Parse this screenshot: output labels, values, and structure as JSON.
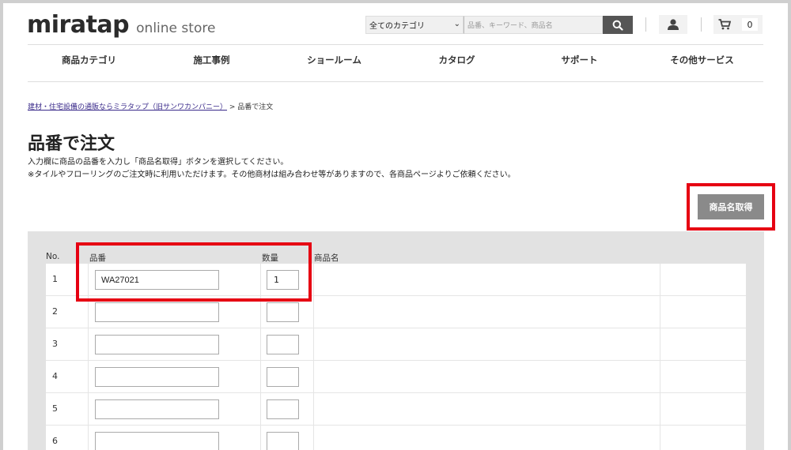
{
  "header": {
    "logo_main": "miratap",
    "logo_sub": "online store",
    "search": {
      "category_value": "全てのカテゴリ",
      "placeholder": "品番、キーワード、商品名"
    },
    "cart_count": "0"
  },
  "nav": {
    "items": [
      {
        "label": "商品カテゴリ"
      },
      {
        "label": "施工事例"
      },
      {
        "label": "ショールーム"
      },
      {
        "label": "カタログ"
      },
      {
        "label": "サポート"
      },
      {
        "label": "その他サービス"
      }
    ]
  },
  "breadcrumb": {
    "link": "建材・住宅設備の通販ならミラタップ（旧サンワカンパニー）",
    "separator": " > ",
    "current": "品番で注文"
  },
  "page": {
    "title": "品番で注文",
    "desc1": "入力欄に商品の品番を入力し「商品名取得」ボタンを選択してください。",
    "desc2": "※タイルやフローリングのご注文時に利用いただけます。その他商材は組み合わせ等がありますので、各商品ページよりご依頼ください。",
    "get_name_button": "商品名取得"
  },
  "table": {
    "headers": {
      "no": "No.",
      "code": "品番",
      "qty": "数量",
      "name": "商品名"
    },
    "rows": [
      {
        "no": "1",
        "code": "WA27021",
        "qty": "1"
      },
      {
        "no": "2",
        "code": "",
        "qty": ""
      },
      {
        "no": "3",
        "code": "",
        "qty": ""
      },
      {
        "no": "4",
        "code": "",
        "qty": ""
      },
      {
        "no": "5",
        "code": "",
        "qty": ""
      },
      {
        "no": "6",
        "code": "",
        "qty": ""
      }
    ]
  },
  "colors": {
    "highlight": "#e60012",
    "button_gray": "#8a8a8a",
    "panel_bg": "#e2e2e2"
  }
}
